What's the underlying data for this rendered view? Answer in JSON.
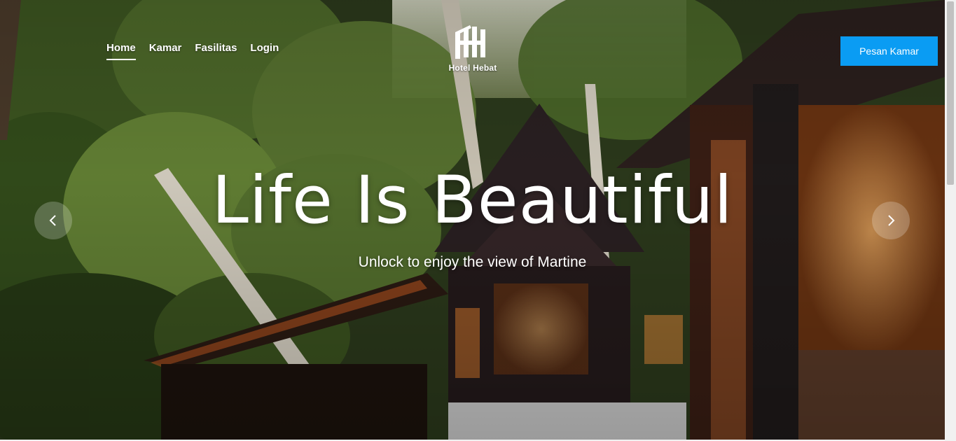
{
  "nav": {
    "items": [
      {
        "label": "Home",
        "active": true
      },
      {
        "label": "Kamar",
        "active": false
      },
      {
        "label": "Fasilitas",
        "active": false
      },
      {
        "label": "Login",
        "active": false
      }
    ]
  },
  "logo": {
    "icon": "hotel-logo-icon",
    "text": "Hotel Hebat"
  },
  "cta": {
    "label": "Pesan Kamar",
    "color": "#0a9cf3"
  },
  "hero": {
    "title": "Life Is Beautiful",
    "subtitle": "Unlock to enjoy the view of Martine",
    "prev_icon": "chevron-left-icon",
    "next_icon": "chevron-right-icon"
  }
}
